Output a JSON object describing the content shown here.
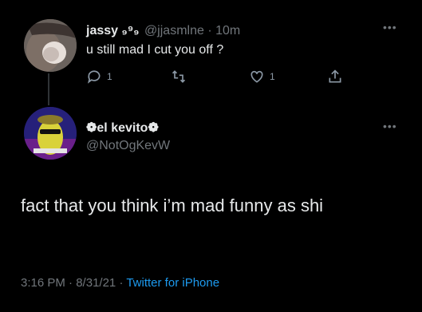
{
  "reply_tweet": {
    "display_name": "jassy ₉⁹₉",
    "handle": "@jjasmlne",
    "separator": "·",
    "time": "10m",
    "text": "u still mad I cut you off ?",
    "more_icon": "more-dots-icon",
    "actions": {
      "reply_count": "1",
      "retweet_count": "",
      "like_count": "1"
    },
    "icons": [
      "reply-icon",
      "retweet-icon",
      "heart-icon",
      "share-icon"
    ]
  },
  "main_tweet": {
    "display_name": "❁el kevito❁",
    "handle": "@NotOgKevW",
    "more_icon": "more-dots-icon",
    "text": "fact that you think i’m mad funny as shi",
    "timestamp_time": "3:16 PM",
    "timestamp_sep1": "·",
    "timestamp_date": "8/31/21",
    "timestamp_sep2": "·",
    "source": "Twitter for iPhone"
  },
  "colors": {
    "background": "#000000",
    "primary_text": "#e7e9ea",
    "secondary_text": "#71767b",
    "link": "#1d9bf0",
    "divider": "#2f3336"
  }
}
